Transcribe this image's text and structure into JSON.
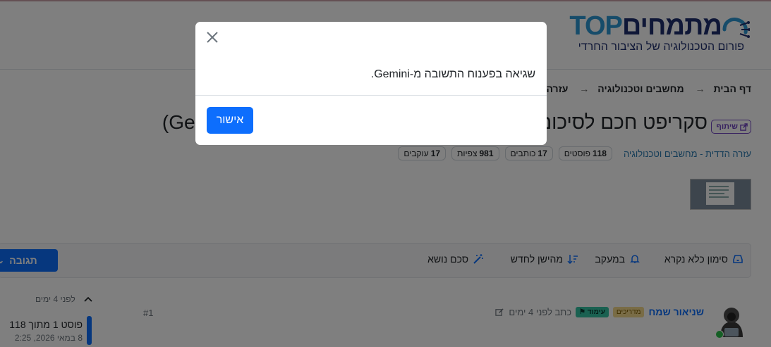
{
  "header": {
    "logo_title_hebrew": "מתמחים",
    "logo_title_top": "TOP",
    "logo_subtitle": "פורום הטכנולוגיה של הציבור החרדי"
  },
  "breadcrumb": [
    "דף הבית",
    "מחשבים וטכנולוגיה",
    "עזרה הדדית"
  ],
  "topic": {
    "badge": "שיתוף",
    "title": "סקריפט חכם לסיכום שרשורים באמצעות בינה מלאכותית (Gemini)",
    "category": "עזרה הדדית - מחשבים וטכנולוגיה",
    "stats": [
      {
        "value": "118",
        "label": "פוסטים"
      },
      {
        "value": "17",
        "label": "כותבים"
      },
      {
        "value": "981",
        "label": "צפיות"
      },
      {
        "value": "17",
        "label": "עוקבים"
      }
    ]
  },
  "toolbar": {
    "mark_read": "סימון כלא נקרא",
    "watching": "במעקב",
    "sort": "מהישן לחדש",
    "summarize": "סכם נושא",
    "reply": "תגובה"
  },
  "post": {
    "author": "שניאור שמח",
    "badge_guides": "מדריכים",
    "badge_focus": "עימוד",
    "wrote": "כתב לפני 4 ימים",
    "number": "#1"
  },
  "timeline": {
    "up_label": "לפני 4 ימים",
    "position": "פוסט 1 מתוך 118",
    "date": "8 במאי 2026, 2:25"
  },
  "modal": {
    "message": "שגיאה בפענוח התשובה מ-Gemini.",
    "ok_label": "אישור"
  },
  "colors": {
    "primary": "#0d6efd",
    "share_badge": "#6f42c1",
    "overlay": "rgba(0,0,0,0.5)"
  }
}
